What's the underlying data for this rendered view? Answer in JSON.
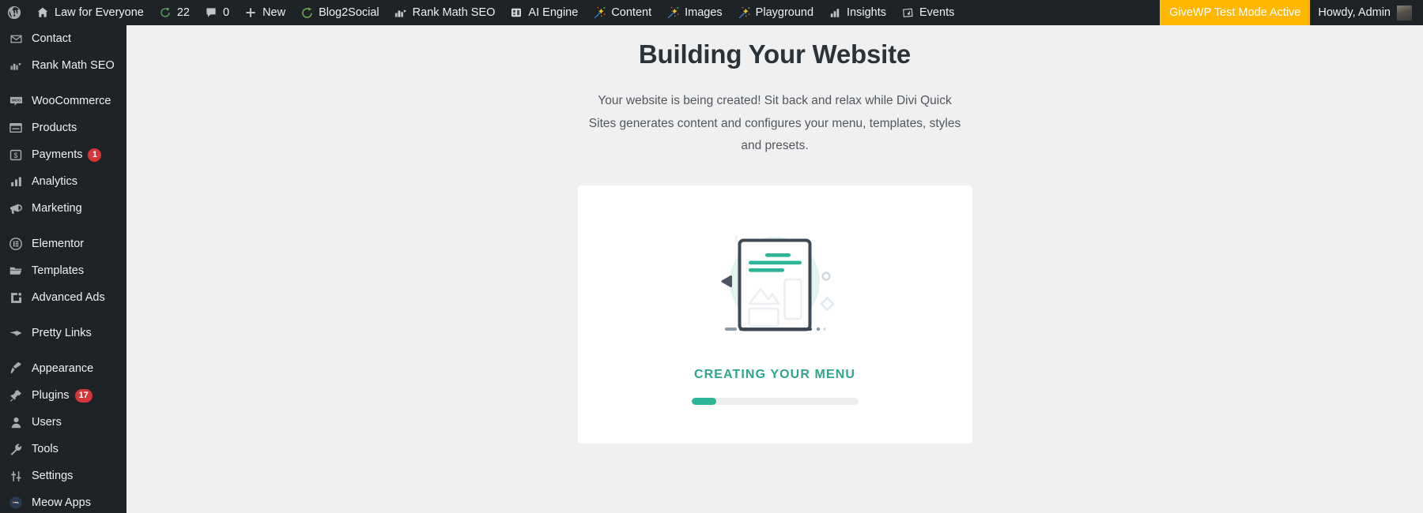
{
  "adminbar": {
    "items": [
      {
        "icon": "wordpress-logo-icon",
        "label": ""
      },
      {
        "icon": "home-icon",
        "label": "Law for Everyone"
      },
      {
        "icon": "update-icon",
        "label": "22"
      },
      {
        "icon": "comment-bubble-icon",
        "label": "0"
      },
      {
        "icon": "plus-icon",
        "label": "New"
      },
      {
        "icon": "blog2social-icon",
        "label": "Blog2Social"
      },
      {
        "icon": "rank-math-icon",
        "label": "Rank Math SEO"
      },
      {
        "icon": "ai-engine-icon",
        "label": "AI Engine"
      },
      {
        "icon": "magic-wand-icon",
        "label": "Content"
      },
      {
        "icon": "magic-wand-icon",
        "label": "Images"
      },
      {
        "icon": "magic-wand-icon",
        "label": "Playground"
      },
      {
        "icon": "bar-chart-icon",
        "label": "Insights"
      },
      {
        "icon": "calendar-icon",
        "label": "Events"
      }
    ],
    "givewp_notice": "GiveWP Test Mode Active",
    "howdy": "Howdy, Admin",
    "notice_bg": "#ffb700"
  },
  "sidebar": {
    "items": [
      {
        "label": "Contact",
        "icon": "envelope-icon",
        "badge": "",
        "gap": false
      },
      {
        "label": "Rank Math SEO",
        "icon": "rank-math-icon",
        "badge": "",
        "gap": false
      },
      {
        "label": "WooCommerce",
        "icon": "woocommerce-icon",
        "badge": "",
        "gap": true
      },
      {
        "label": "Products",
        "icon": "products-icon",
        "badge": "",
        "gap": false
      },
      {
        "label": "Payments",
        "icon": "payments-icon",
        "badge": "1",
        "gap": false
      },
      {
        "label": "Analytics",
        "icon": "analytics-icon",
        "badge": "",
        "gap": false
      },
      {
        "label": "Marketing",
        "icon": "megaphone-icon",
        "badge": "",
        "gap": false
      },
      {
        "label": "Elementor",
        "icon": "elementor-icon",
        "badge": "",
        "gap": true
      },
      {
        "label": "Templates",
        "icon": "folder-icon",
        "badge": "",
        "gap": false
      },
      {
        "label": "Advanced Ads",
        "icon": "advanced-ads-icon",
        "badge": "",
        "gap": false
      },
      {
        "label": "Pretty Links",
        "icon": "pretty-links-icon",
        "badge": "",
        "gap": true
      },
      {
        "label": "Appearance",
        "icon": "paintbrush-icon",
        "badge": "",
        "gap": true
      },
      {
        "label": "Plugins",
        "icon": "plug-icon",
        "badge": "17",
        "gap": false
      },
      {
        "label": "Users",
        "icon": "user-icon",
        "badge": "",
        "gap": false
      },
      {
        "label": "Tools",
        "icon": "wrench-icon",
        "badge": "",
        "gap": false
      },
      {
        "label": "Settings",
        "icon": "settings-sliders-icon",
        "badge": "",
        "gap": false
      },
      {
        "label": "Meow Apps",
        "icon": "meow-apps-icon",
        "badge": "",
        "gap": false
      }
    ],
    "badge_color": "#d63638"
  },
  "main": {
    "title": "Building Your Website",
    "description": "Your website is being created! Sit back and relax while Divi Quick Sites generates content and configures your menu, templates, styles and presets.",
    "card": {
      "illustration": "website-layout-illustration",
      "status": "Creating Your Menu",
      "progress_percent": 15,
      "accent_color": "#2bb596",
      "status_color": "#2ea58c"
    }
  }
}
